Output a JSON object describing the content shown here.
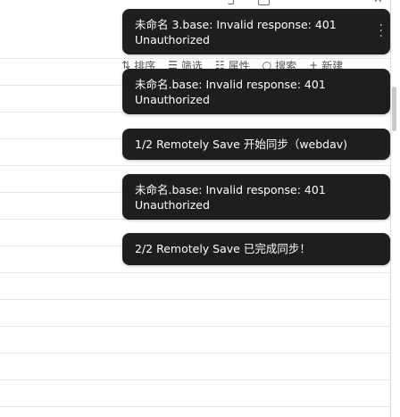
{
  "toolbar": {
    "items": [
      {
        "icon": "sort-icon",
        "glyph": "⇅",
        "label": "排序"
      },
      {
        "icon": "filter-icon",
        "glyph": "☰",
        "label": "筛选"
      },
      {
        "icon": "properties-icon",
        "glyph": "☷",
        "label": "属性"
      },
      {
        "icon": "search-icon",
        "glyph": "○",
        "label": "搜索"
      },
      {
        "icon": "plus-icon",
        "glyph": "+",
        "label": "新建"
      }
    ]
  },
  "window": {
    "close_glyph": "✕"
  },
  "notices": [
    {
      "text": "未命名 3.base: Invalid response: 401\nUnauthorized",
      "has_menu": true
    },
    {
      "text": "未命名.base: Invalid response: 401\nUnauthorized",
      "has_menu": false
    },
    {
      "text": "1/2 Remotely Save 开始同步（webdav)",
      "has_menu": false
    },
    {
      "text": "未命名.base: Invalid response: 401\nUnauthorized",
      "has_menu": false
    },
    {
      "text": "2/2 Remotely Save 已完成同步！",
      "has_menu": false
    }
  ],
  "colors": {
    "notice_bg": "#1e1e1e",
    "notice_text": "#ffffff",
    "row_line": "#e6e6e6"
  }
}
